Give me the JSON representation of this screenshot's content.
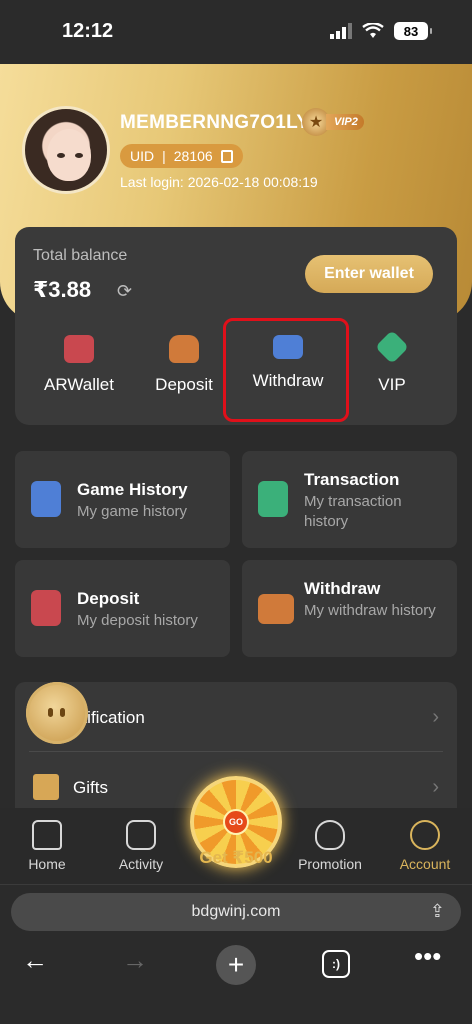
{
  "status": {
    "time": "12:12",
    "battery": "83"
  },
  "profile": {
    "username": "MEMBERNNG7O1LY",
    "vip": "VIP2",
    "uid_label": "UID",
    "uid_sep": "|",
    "uid": "28106",
    "last_login": "Last login: 2026-02-18 00:08:19"
  },
  "balance": {
    "label": "Total balance",
    "value": "₹3.88",
    "enter_wallet": "Enter wallet"
  },
  "quick_actions": [
    {
      "label": "ARWallet",
      "icon": "wallet-icon",
      "color": "#c9484f"
    },
    {
      "label": "Deposit",
      "icon": "deposit-bag-icon",
      "color": "#d07a3a"
    },
    {
      "label": "Withdraw",
      "icon": "card-icon",
      "color": "#4f7fd6"
    },
    {
      "label": "VIP",
      "icon": "vip-gem-icon",
      "color": "#3bb07a"
    }
  ],
  "history_tiles": [
    {
      "title": "Game History",
      "sub": "My game history",
      "icon": "game-history-icon",
      "color": "#4f7fd6"
    },
    {
      "title": "Transaction",
      "sub": "My transaction history",
      "icon": "transaction-icon",
      "color": "#3bb07a"
    },
    {
      "title": "Deposit",
      "sub": "My deposit history",
      "icon": "deposit-history-icon",
      "color": "#c9484f"
    },
    {
      "title": "Withdraw",
      "sub": "My withdraw history",
      "icon": "withdraw-history-icon",
      "color": "#d07a3a"
    }
  ],
  "list": {
    "notification": "otification",
    "gifts": "Gifts"
  },
  "promo": {
    "wheel_go": "GO",
    "label": "Get ₹500"
  },
  "nav": [
    {
      "label": "Home",
      "icon": "home-icon"
    },
    {
      "label": "Activity",
      "icon": "activity-icon"
    },
    {
      "label": "Promotion",
      "icon": "promotion-icon"
    },
    {
      "label": "Account",
      "icon": "account-icon"
    }
  ],
  "browser": {
    "url": "bdgwinj.com",
    "tabs_icon_text": ":)"
  },
  "colors": {
    "accent": "#d9b45c",
    "highlight": "#e0101a"
  }
}
